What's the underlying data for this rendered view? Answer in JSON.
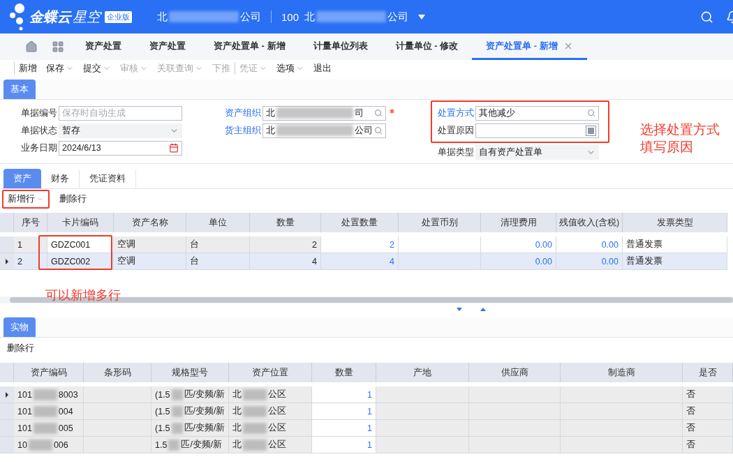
{
  "header": {
    "brand": "金蝶云",
    "brand_sub": "星空",
    "edition": "企业版",
    "org": {
      "start": "北",
      "end": "公司"
    },
    "org_code": "100",
    "org2": {
      "start": "北",
      "end": "公司"
    }
  },
  "tabs": [
    {
      "label": "资产处置",
      "selected": false,
      "closable": false
    },
    {
      "label": "资产处置",
      "selected": false,
      "closable": false
    },
    {
      "label": "资产处置单 - 新增",
      "selected": false,
      "closable": false
    },
    {
      "label": "计量单位列表",
      "selected": false,
      "closable": false
    },
    {
      "label": "计量单位 - 修改",
      "selected": false,
      "closable": false
    },
    {
      "label": "资产处置单 - 新增",
      "selected": true,
      "closable": true
    }
  ],
  "toolbar": [
    {
      "label": "新增",
      "disabled": false,
      "dropdown": false,
      "separator": true
    },
    {
      "label": "保存",
      "disabled": false,
      "dropdown": true,
      "separator": false
    },
    {
      "label": "提交",
      "disabled": false,
      "dropdown": true,
      "separator": false
    },
    {
      "label": "审核",
      "disabled": true,
      "dropdown": true,
      "separator": false
    },
    {
      "label": "关联查询",
      "disabled": true,
      "dropdown": true,
      "separator": false
    },
    {
      "label": "下推",
      "disabled": true,
      "dropdown": false,
      "separator": false
    },
    {
      "label": "凭证",
      "disabled": true,
      "dropdown": true,
      "separator": true
    },
    {
      "label": "选项",
      "disabled": false,
      "dropdown": true,
      "separator": false
    },
    {
      "label": "退出",
      "disabled": false,
      "dropdown": false,
      "separator": false
    }
  ],
  "basic": {
    "tab": "基本",
    "columns": [
      [
        {
          "label": "单据编号",
          "kind": "text",
          "placeholder": "保存时自动生成",
          "link": false,
          "required": false
        },
        {
          "label": "单据状态",
          "kind": "select",
          "value": "暂存",
          "link": false,
          "required": false
        },
        {
          "label": "业务日期",
          "kind": "date",
          "value": "2024/6/13",
          "link": false,
          "required": false
        }
      ],
      [
        {
          "label": "资产组织",
          "kind": "lookup",
          "masked": {
            "start": "北",
            "end": "司"
          },
          "link": true,
          "required": true
        },
        {
          "label": "货主组织",
          "kind": "lookup",
          "masked": {
            "start": "北",
            "end": "公司"
          },
          "link": true,
          "required": false
        }
      ],
      [
        {
          "label": "处置方式",
          "kind": "lookup",
          "value": "其他减少",
          "link": true,
          "required": false
        },
        {
          "label": "处置原因",
          "kind": "multilang",
          "link": false,
          "required": false
        },
        {
          "label": "单据类型",
          "kind": "select",
          "value": "自有资产处置单",
          "link": false,
          "required": false
        }
      ]
    ],
    "note": [
      "选择处置方式",
      "填写原因"
    ]
  },
  "detail_tabs": [
    {
      "label": "资产",
      "selected": true
    },
    {
      "label": "财务",
      "selected": false
    },
    {
      "label": "凭证资料",
      "selected": false
    }
  ],
  "detail_actions": [
    {
      "label": "新增行",
      "dropdown": true
    },
    {
      "label": "删除行",
      "dropdown": false
    }
  ],
  "assets": {
    "columns": [
      {
        "label": "序号",
        "editable": false
      },
      {
        "label": "卡片编码",
        "editable": true
      },
      {
        "label": "资产名称",
        "editable": false
      },
      {
        "label": "单位",
        "editable": false
      },
      {
        "label": "数量",
        "editable": false
      },
      {
        "label": "处置数量",
        "editable": true
      },
      {
        "label": "处置币别",
        "editable": true
      },
      {
        "label": "清理费用",
        "editable": true
      },
      {
        "label": "残值收入(含税)",
        "editable": true
      },
      {
        "label": "发票类型",
        "editable": true
      }
    ],
    "rows": [
      {
        "selected": false,
        "cells": [
          "1",
          "GDZC001",
          "空调",
          "台",
          "2",
          "2",
          "",
          "0.00",
          "0.00",
          "普通发票"
        ]
      },
      {
        "selected": true,
        "cells": [
          "2",
          "GDZC002",
          "空调",
          "台",
          "4",
          "4",
          "",
          "0.00",
          "0.00",
          "普通发票"
        ]
      }
    ],
    "note": "可以新增多行"
  },
  "physical": {
    "tab": "实物",
    "action": "删除行",
    "columns": [
      {
        "label": "资产编码",
        "editable": false
      },
      {
        "label": "条形码",
        "editable": false
      },
      {
        "label": "规格型号",
        "editable": false
      },
      {
        "label": "资产位置",
        "editable": false
      },
      {
        "label": "数量",
        "editable": true
      },
      {
        "label": "产地",
        "editable": false
      },
      {
        "label": "供应商",
        "editable": false
      },
      {
        "label": "制造商",
        "editable": false
      },
      {
        "label": "是否",
        "editable": false
      }
    ],
    "rows": [
      {
        "selected": true,
        "cells": [
          {
            "start": "101",
            "end": "8003"
          },
          "",
          {
            "start": "(1.5",
            "end": "匹/变频/新"
          },
          {
            "start": "北",
            "end": "公区"
          },
          "1",
          "",
          "",
          "",
          "否"
        ]
      },
      {
        "selected": false,
        "cells": [
          {
            "start": "101",
            "end": "004"
          },
          "",
          {
            "start": "(1.5",
            "end": "匹/变频/新"
          },
          {
            "start": "北",
            "end": "公区"
          },
          "1",
          "",
          "",
          "",
          "否"
        ]
      },
      {
        "selected": false,
        "cells": [
          {
            "start": "101",
            "end": "005"
          },
          "",
          {
            "start": "(1.5",
            "end": "匹/变频/新"
          },
          {
            "start": "北",
            "end": "公区"
          },
          "1",
          "",
          "",
          "",
          "否"
        ]
      },
      {
        "selected": false,
        "cells": [
          {
            "start": "10",
            "end": "006"
          },
          "",
          {
            "start": "1.5",
            "end": "匹/变频/新"
          },
          {
            "start": "北",
            "end": "公区"
          },
          "1",
          "",
          "",
          "",
          "否"
        ]
      }
    ]
  }
}
